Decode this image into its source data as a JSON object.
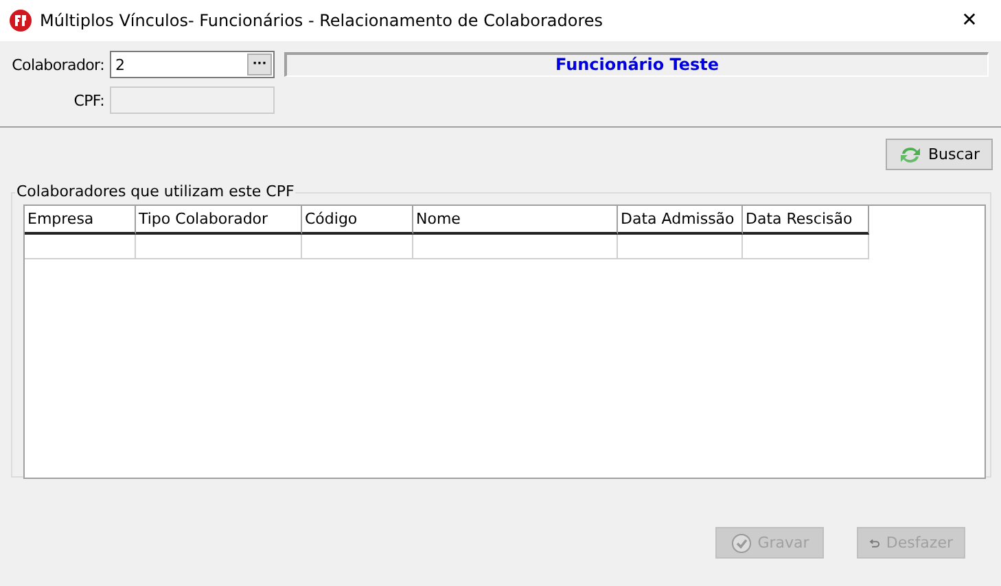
{
  "window": {
    "title": "Múltiplos Vínculos- Funcionários - Relacionamento de Colaboradores",
    "close": "✕"
  },
  "form": {
    "colaborador_label": "Colaborador:",
    "colaborador_value": "2",
    "lookup_button": "···",
    "name_display": "Funcionário Teste",
    "cpf_label": "CPF:"
  },
  "search_button": {
    "label": "Buscar",
    "disabled": false
  },
  "group": {
    "title": "Colaboradores que utilizam este CPF"
  },
  "table": {
    "columns": [
      "Empresa",
      "Tipo Colaborador",
      "Código",
      "Nome",
      "Data Admissão",
      "Data Rescisão"
    ]
  },
  "buttons": [
    {
      "label": "Gravar",
      "kind": "save",
      "disabled": true
    },
    {
      "label": "Desfazer",
      "kind": "undo",
      "disabled": true
    }
  ]
}
